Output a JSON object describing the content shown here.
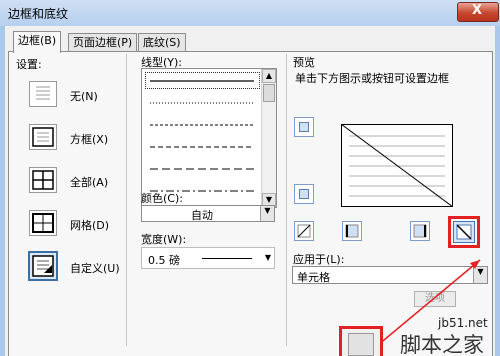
{
  "window": {
    "title": "边框和底纹",
    "close_glyph": "X"
  },
  "tabs": [
    {
      "label": "边框(B)",
      "active": true
    },
    {
      "label": "页面边框(P)",
      "active": false
    },
    {
      "label": "底纹(S)",
      "active": false
    }
  ],
  "settings": {
    "heading": "设置:",
    "items": [
      {
        "label": "无(N)",
        "icon": "no-border-icon"
      },
      {
        "label": "方框(X)",
        "icon": "box-border-icon"
      },
      {
        "label": "全部(A)",
        "icon": "all-borders-icon"
      },
      {
        "label": "网格(D)",
        "icon": "grid-border-icon"
      },
      {
        "label": "自定义(U)",
        "icon": "custom-border-icon",
        "selected": true
      }
    ]
  },
  "style": {
    "heading": "线型(Y):",
    "lines": [
      "solid",
      "dotted",
      "dash-small",
      "dashed",
      "dash-large",
      "dash-dot"
    ]
  },
  "color": {
    "heading": "颜色(C):",
    "value": "自动"
  },
  "width": {
    "heading": "宽度(W):",
    "value": "0.5 磅"
  },
  "preview": {
    "heading": "预览",
    "hint": "单击下方图示或按钮可设置边框"
  },
  "apply_to": {
    "heading": "应用于(L):",
    "value": "单元格",
    "options_button": "选项"
  },
  "watermark": {
    "site": "jb51.net",
    "name": "脚本之家"
  },
  "colors": {
    "highlight": "#e52022",
    "accent": "#3c6ea8"
  }
}
